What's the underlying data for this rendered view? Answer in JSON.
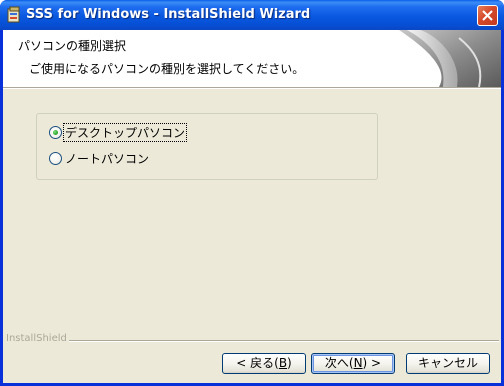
{
  "window": {
    "title": "SSS for Windows - InstallShield Wizard",
    "app_icon": "installer-icon",
    "close_icon": "close-icon"
  },
  "banner": {
    "title": "パソコンの種別選択",
    "subtitle": "ご使用になるパソコンの種別を選択してください。"
  },
  "options": [
    {
      "label": "デスクトップパソコン",
      "selected": true
    },
    {
      "label": "ノートパソコン",
      "selected": false
    }
  ],
  "footer": {
    "brand": "InstallShield",
    "back_label": "< 戻る(",
    "back_key": "B",
    "back_suffix": ")",
    "next_label": "次へ(",
    "next_key": "N",
    "next_suffix": ") >",
    "cancel_label": "キャンセル"
  }
}
